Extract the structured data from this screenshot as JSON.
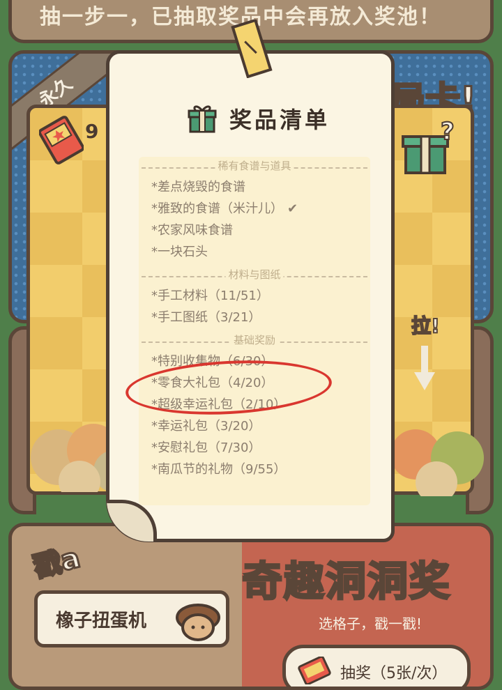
{
  "top_banner": {
    "text": "抽一步一，已抽取奖品中会再放入奖池！"
  },
  "mid_panel": {
    "ribbon": "永久",
    "card_text": "局卡!",
    "ticket_count": "9",
    "pull_label": "拉!"
  },
  "popup": {
    "title": "奖品清单",
    "sections": [
      {
        "label": "稀有食谱与道具",
        "items": [
          "*差点烧毁的食谱",
          "*雅致的食谱（米汁儿）",
          "*农家风味食谱",
          "*一块石头"
        ]
      },
      {
        "label": "材料与图纸",
        "items": [
          "*手工材料（11/51）",
          "*手工图纸（3/21）"
        ]
      },
      {
        "label": "基础奖励",
        "items": [
          "*特别收集物（6/30）",
          "*零食大礼包（4/20）",
          "*超级幸运礼包（2/10）",
          "*幸运礼包（3/20）",
          "*安慰礼包（7/30）",
          "*南瓜节的礼物（9/55）"
        ]
      }
    ],
    "check_mark": "✔",
    "colors": {
      "annotation_circle": "#d9372f",
      "paper": "#fbf5e3"
    }
  },
  "bottom_panel": {
    "stamp": "戳a",
    "gacha_button": "橡子扭蛋机",
    "fun_title": "奇趣洞洞奖",
    "fun_sub": "选格子，戳一戳!",
    "draw_button": "抽奖（5张/次）"
  }
}
